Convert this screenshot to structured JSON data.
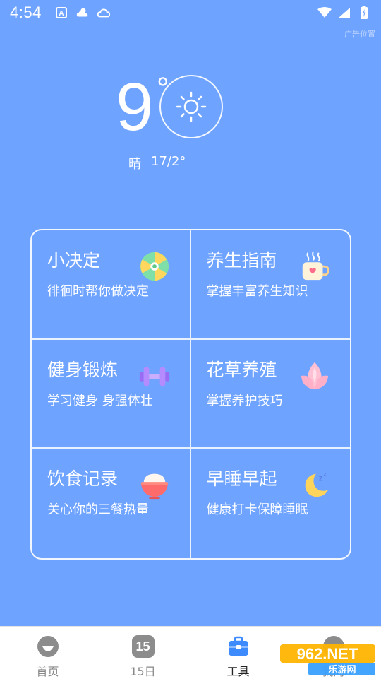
{
  "status_bar": {
    "time": "4:54"
  },
  "top_hint": "广告位置",
  "weather": {
    "temperature": "9",
    "degree_symbol": "°",
    "condition": "晴",
    "range": "17/2°"
  },
  "tools": [
    {
      "title": "小决定",
      "subtitle": "徘徊时帮你做决定",
      "icon": "wheel-icon"
    },
    {
      "title": "养生指南",
      "subtitle": "掌握丰富养生知识",
      "icon": "tea-cup-icon"
    },
    {
      "title": "健身锻炼",
      "subtitle": "学习健身 身强体壮",
      "icon": "dumbbell-icon"
    },
    {
      "title": "花草养殖",
      "subtitle": "掌握养护技巧",
      "icon": "lotus-icon"
    },
    {
      "title": "饮食记录",
      "subtitle": "关心你的三餐热量",
      "icon": "rice-bowl-icon"
    },
    {
      "title": "早睡早起",
      "subtitle": "健康打卡保障睡眠",
      "icon": "moon-icon"
    }
  ],
  "bottom_nav": {
    "items": [
      {
        "label": "首页",
        "icon": "home-icon"
      },
      {
        "label": "15日",
        "icon": "calendar-icon",
        "badge": "15"
      },
      {
        "label": "工具",
        "icon": "toolbox-icon",
        "active": true
      },
      {
        "label": "我的",
        "icon": "profile-icon"
      }
    ]
  },
  "watermark": {
    "brand": "962.NET",
    "sub": "乐游网"
  },
  "colors": {
    "background": "#6ea3ff",
    "nav_active": "#3d8bff"
  }
}
